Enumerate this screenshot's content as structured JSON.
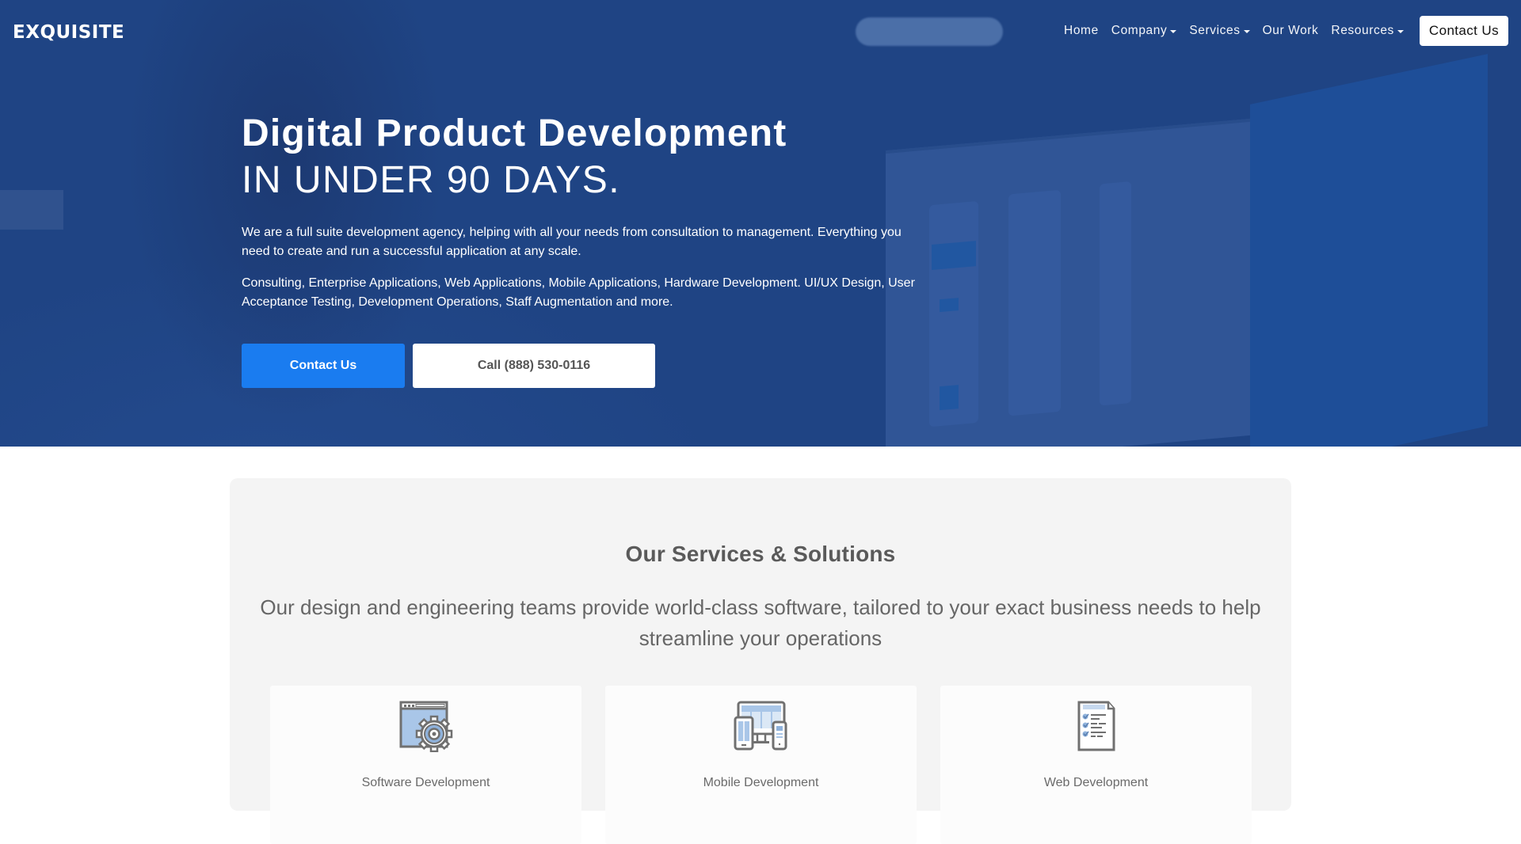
{
  "brand": {
    "name": "EXQUISITE"
  },
  "nav": {
    "items": [
      {
        "label": "Home",
        "has_dropdown": false
      },
      {
        "label": "Company",
        "has_dropdown": true
      },
      {
        "label": "Services",
        "has_dropdown": true
      },
      {
        "label": "Our Work",
        "has_dropdown": false
      },
      {
        "label": "Resources",
        "has_dropdown": true
      }
    ],
    "cta_label": "Contact Us"
  },
  "hero": {
    "title": "Digital Product Development",
    "subtitle": "IN UNDER 90 DAYS.",
    "paragraph1": "We are a full suite development agency, helping with all your needs from consultation to management. Everything you need to create and run a successful application at any scale.",
    "paragraph2": "Consulting, Enterprise Applications, Web Applications, Mobile Applications, Hardware Development. UI/UX Design, User Acceptance Testing, Development Operations, Staff Augmentation and more.",
    "primary_button": "Contact Us",
    "secondary_button": "Call (888) 530-0116"
  },
  "services": {
    "title": "Our Services & Solutions",
    "description": "Our design and engineering teams provide world-class software, tailored to your exact business needs to help streamline your operations",
    "cards": [
      {
        "title": "Software Development",
        "icon": "window-gear-icon"
      },
      {
        "title": "Mobile Development",
        "icon": "devices-icon"
      },
      {
        "title": "Web Development",
        "icon": "checklist-document-icon"
      }
    ]
  },
  "colors": {
    "hero_bg": "#1f4484",
    "primary_button": "#1a7cf0",
    "icon_stroke": "#707070",
    "icon_fill": "#a9c6e8"
  }
}
